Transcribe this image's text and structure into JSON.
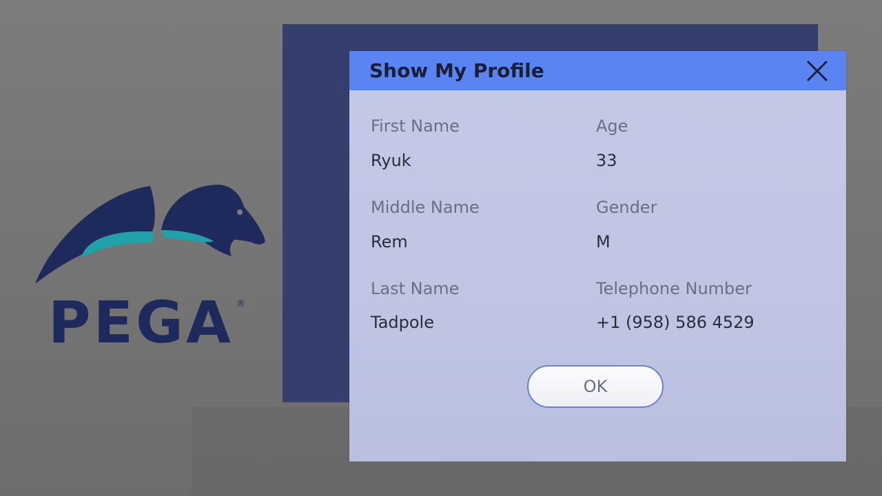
{
  "logo": {
    "wordmark": "PEGA",
    "registered_mark": "®"
  },
  "dialog": {
    "title": "Show My Profile",
    "close_icon": "close-icon",
    "fields": {
      "first_name": {
        "label": "First Name",
        "value": "Ryuk"
      },
      "middle_name": {
        "label": "Middle Name",
        "value": "Rem"
      },
      "last_name": {
        "label": "Last Name",
        "value": "Tadpole"
      },
      "age": {
        "label": "Age",
        "value": "33"
      },
      "gender": {
        "label": "Gender",
        "value": "M"
      },
      "telephone": {
        "label": "Telephone Number",
        "value": "+1 (958) 586 4529"
      }
    },
    "ok_label": "OK"
  },
  "colors": {
    "background": "#777777",
    "brand_navy": "#1f2a5c",
    "brand_teal": "#1fa3a8",
    "backdrop_window": "#343f6e",
    "dialog_header": "#5b84f3",
    "dialog_body": "#c2c7e5",
    "label_text": "#6b6f82",
    "value_text": "#2a2d3a"
  }
}
